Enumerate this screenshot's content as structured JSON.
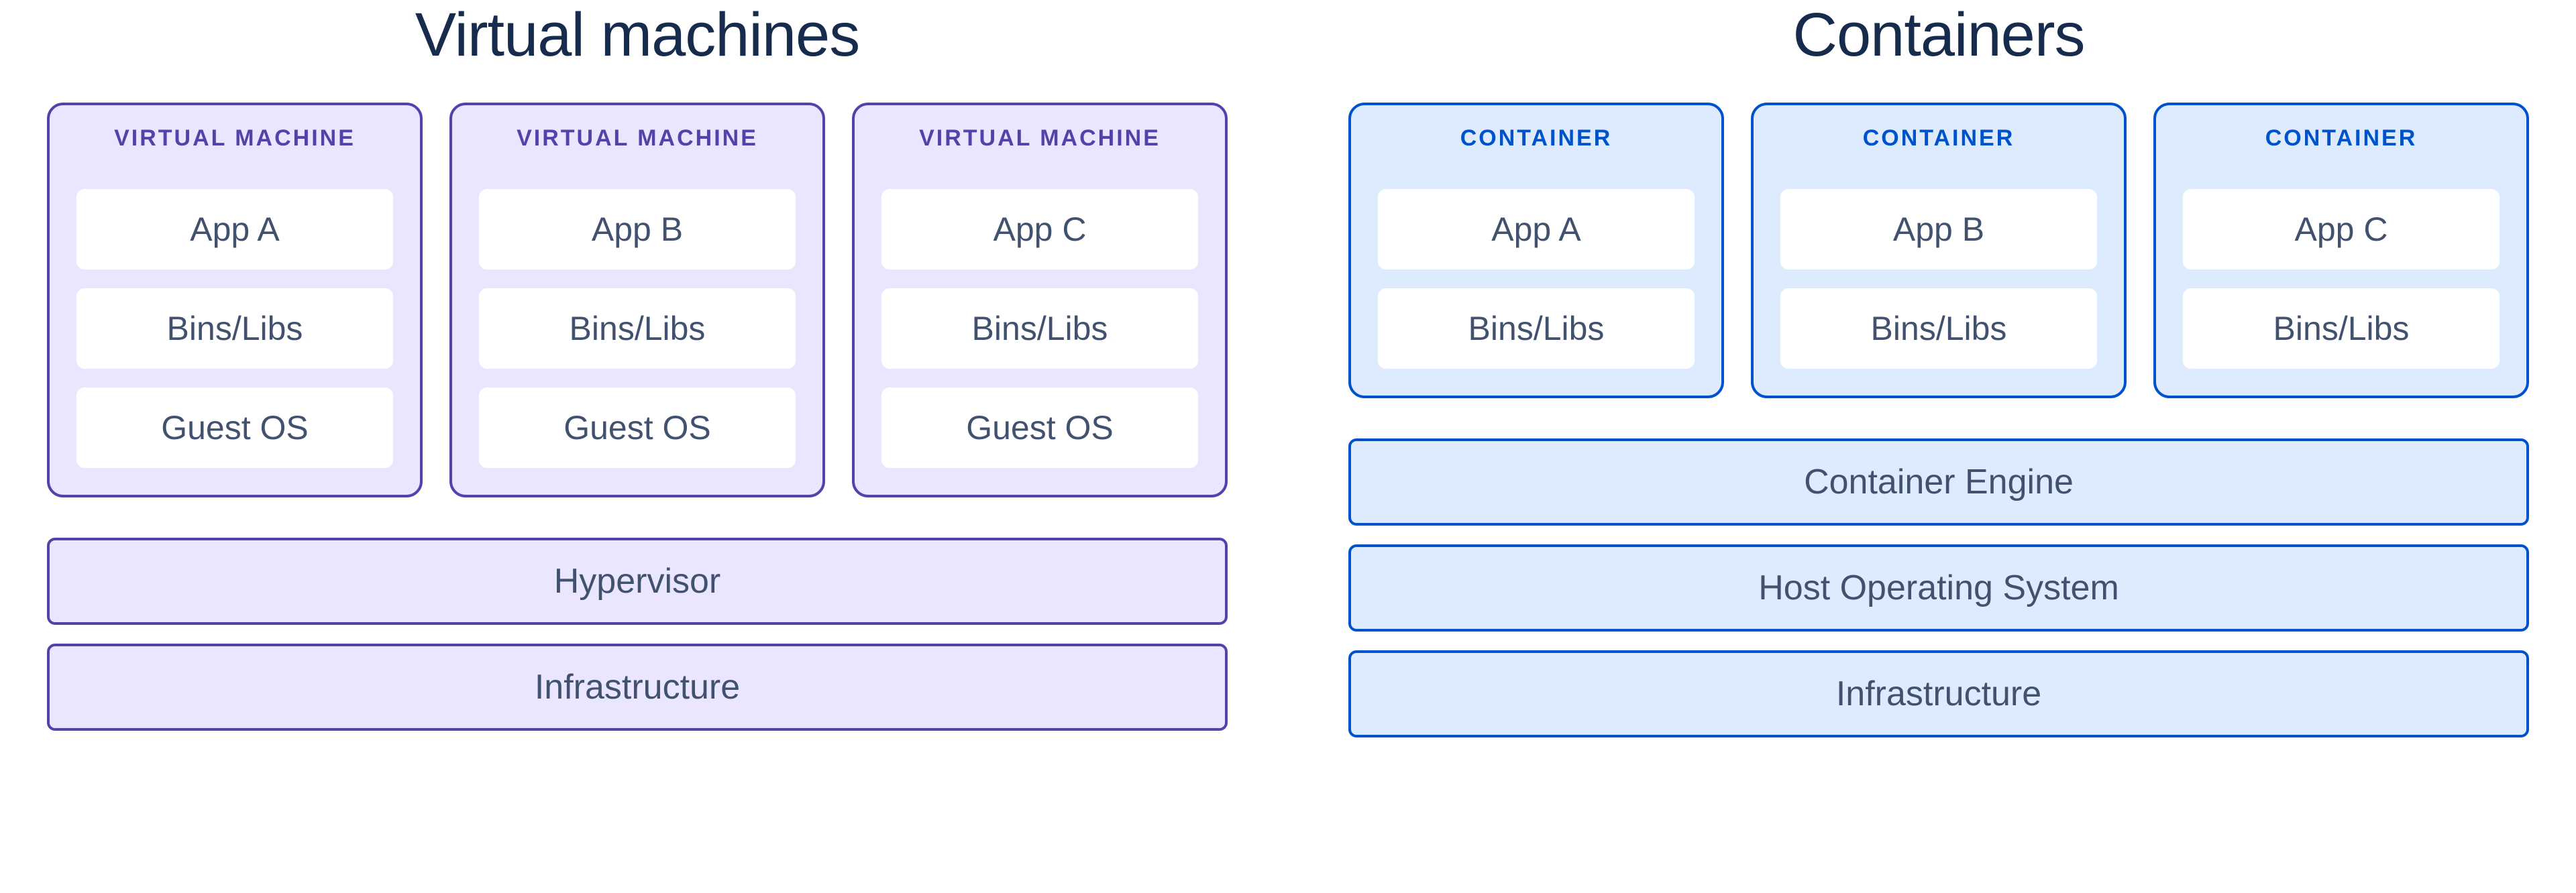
{
  "left": {
    "title": "Virtual machines",
    "box_label": "VIRTUAL MACHINE",
    "boxes": [
      {
        "items": [
          "App A",
          "Bins/Libs",
          "Guest OS"
        ]
      },
      {
        "items": [
          "App B",
          "Bins/Libs",
          "Guest OS"
        ]
      },
      {
        "items": [
          "App C",
          "Bins/Libs",
          "Guest OS"
        ]
      }
    ],
    "stack": [
      "Hypervisor",
      "Infrastructure"
    ]
  },
  "right": {
    "title": "Containers",
    "box_label": "CONTAINER",
    "boxes": [
      {
        "items": [
          "App A",
          "Bins/Libs"
        ]
      },
      {
        "items": [
          "App B",
          "Bins/Libs"
        ]
      },
      {
        "items": [
          "App C",
          "Bins/Libs"
        ]
      }
    ],
    "stack": [
      "Container Engine",
      "Host Operating System",
      "Infrastructure"
    ]
  }
}
